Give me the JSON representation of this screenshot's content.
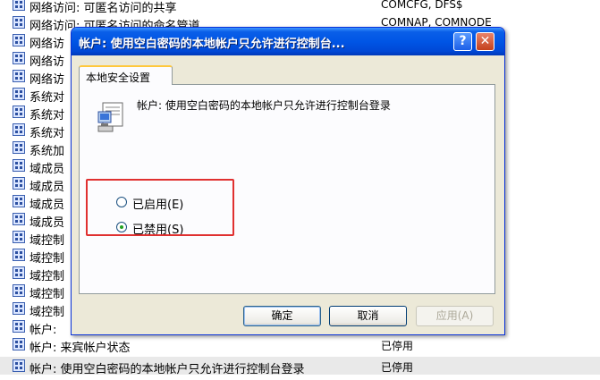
{
  "background_list": {
    "rows": [
      {
        "name": "网络访问: 可匿名访问的共享",
        "value": "COMCFG, DFS$"
      },
      {
        "name": "网络访问: 可匿名访问的命名管道",
        "value": "COMNAP, COMNODE"
      },
      {
        "name": "网络访",
        "value": ""
      },
      {
        "name": "网络访",
        "value": ""
      },
      {
        "name": "网络访",
        "value": ""
      },
      {
        "name": "系统对",
        "value": ""
      },
      {
        "name": "系统对",
        "value": ""
      },
      {
        "name": "系统对",
        "value": ""
      },
      {
        "name": "系统加",
        "value": ""
      },
      {
        "name": "域成员",
        "value": ""
      },
      {
        "name": "域成员",
        "value": ""
      },
      {
        "name": "域成员",
        "value": ""
      },
      {
        "name": "域成员",
        "value": ""
      },
      {
        "name": "域控制",
        "value": ""
      },
      {
        "name": "域控制",
        "value": ""
      },
      {
        "name": "域控制",
        "value": ""
      },
      {
        "name": "域控制",
        "value": ""
      },
      {
        "name": "域控制",
        "value": ""
      },
      {
        "name": "帐户:",
        "value": ""
      },
      {
        "name": "帐户: 来宾帐户状态",
        "value": "已停用"
      },
      {
        "name": "帐户: 使用空白密码的本地帐户只允许进行控制台登录",
        "value": "已停用"
      }
    ]
  },
  "dialog": {
    "title": "帐户: 使用空白密码的本地帐户只允许进行控制台...",
    "help_label": "?",
    "close_label": "✕",
    "tab_label": "本地安全设置",
    "policy_text": "帐户: 使用空白密码的本地帐户只允许进行控制台登录",
    "options": [
      {
        "label": "已启用(E)",
        "checked": false
      },
      {
        "label": "已禁用(S)",
        "checked": true
      }
    ],
    "buttons": {
      "ok": "确定",
      "cancel": "取消",
      "apply": "应用(A)"
    }
  },
  "colors": {
    "title_bar": "#0055e5",
    "highlight_box": "#e03030",
    "radio_checked": "#21a121"
  },
  "icons": {
    "policy": "computer-policy-icon",
    "row": "policy-row-icon"
  }
}
